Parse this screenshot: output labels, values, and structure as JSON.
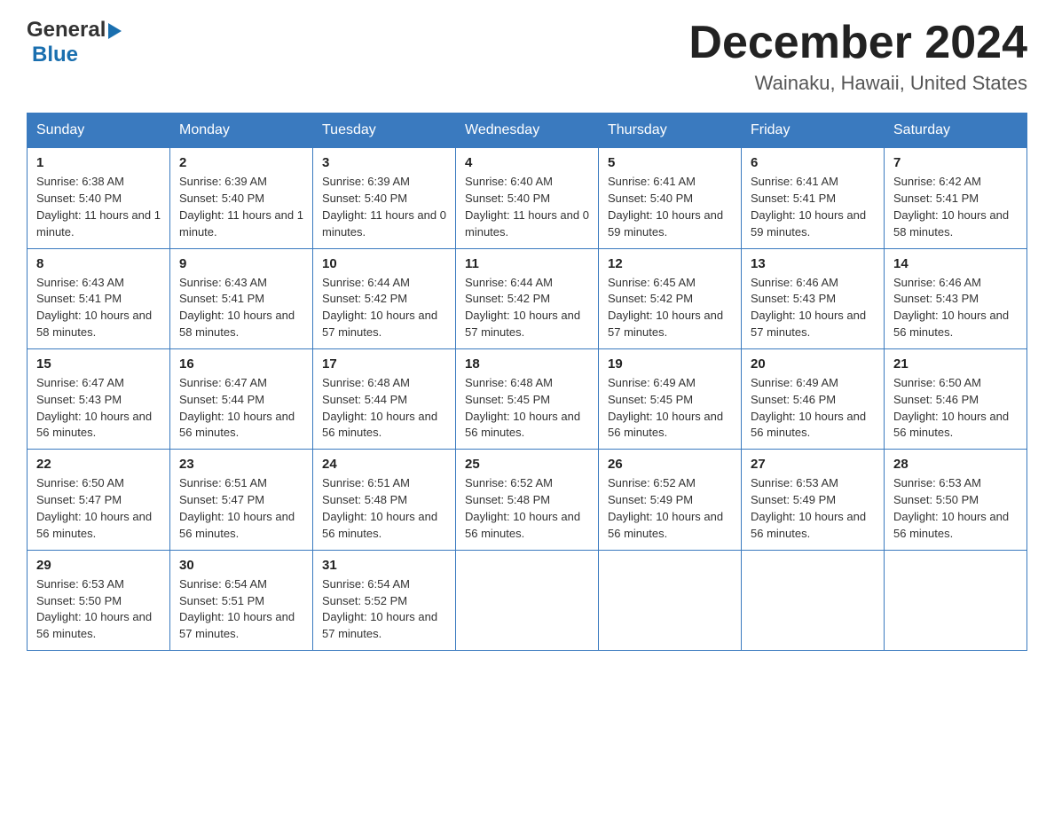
{
  "header": {
    "logo_general": "General",
    "logo_blue": "Blue",
    "month_title": "December 2024",
    "location": "Wainaku, Hawaii, United States"
  },
  "weekdays": [
    "Sunday",
    "Monday",
    "Tuesday",
    "Wednesday",
    "Thursday",
    "Friday",
    "Saturday"
  ],
  "weeks": [
    [
      {
        "day": "1",
        "sunrise": "6:38 AM",
        "sunset": "5:40 PM",
        "daylight": "11 hours and 1 minute."
      },
      {
        "day": "2",
        "sunrise": "6:39 AM",
        "sunset": "5:40 PM",
        "daylight": "11 hours and 1 minute."
      },
      {
        "day": "3",
        "sunrise": "6:39 AM",
        "sunset": "5:40 PM",
        "daylight": "11 hours and 0 minutes."
      },
      {
        "day": "4",
        "sunrise": "6:40 AM",
        "sunset": "5:40 PM",
        "daylight": "11 hours and 0 minutes."
      },
      {
        "day": "5",
        "sunrise": "6:41 AM",
        "sunset": "5:40 PM",
        "daylight": "10 hours and 59 minutes."
      },
      {
        "day": "6",
        "sunrise": "6:41 AM",
        "sunset": "5:41 PM",
        "daylight": "10 hours and 59 minutes."
      },
      {
        "day": "7",
        "sunrise": "6:42 AM",
        "sunset": "5:41 PM",
        "daylight": "10 hours and 58 minutes."
      }
    ],
    [
      {
        "day": "8",
        "sunrise": "6:43 AM",
        "sunset": "5:41 PM",
        "daylight": "10 hours and 58 minutes."
      },
      {
        "day": "9",
        "sunrise": "6:43 AM",
        "sunset": "5:41 PM",
        "daylight": "10 hours and 58 minutes."
      },
      {
        "day": "10",
        "sunrise": "6:44 AM",
        "sunset": "5:42 PM",
        "daylight": "10 hours and 57 minutes."
      },
      {
        "day": "11",
        "sunrise": "6:44 AM",
        "sunset": "5:42 PM",
        "daylight": "10 hours and 57 minutes."
      },
      {
        "day": "12",
        "sunrise": "6:45 AM",
        "sunset": "5:42 PM",
        "daylight": "10 hours and 57 minutes."
      },
      {
        "day": "13",
        "sunrise": "6:46 AM",
        "sunset": "5:43 PM",
        "daylight": "10 hours and 57 minutes."
      },
      {
        "day": "14",
        "sunrise": "6:46 AM",
        "sunset": "5:43 PM",
        "daylight": "10 hours and 56 minutes."
      }
    ],
    [
      {
        "day": "15",
        "sunrise": "6:47 AM",
        "sunset": "5:43 PM",
        "daylight": "10 hours and 56 minutes."
      },
      {
        "day": "16",
        "sunrise": "6:47 AM",
        "sunset": "5:44 PM",
        "daylight": "10 hours and 56 minutes."
      },
      {
        "day": "17",
        "sunrise": "6:48 AM",
        "sunset": "5:44 PM",
        "daylight": "10 hours and 56 minutes."
      },
      {
        "day": "18",
        "sunrise": "6:48 AM",
        "sunset": "5:45 PM",
        "daylight": "10 hours and 56 minutes."
      },
      {
        "day": "19",
        "sunrise": "6:49 AM",
        "sunset": "5:45 PM",
        "daylight": "10 hours and 56 minutes."
      },
      {
        "day": "20",
        "sunrise": "6:49 AM",
        "sunset": "5:46 PM",
        "daylight": "10 hours and 56 minutes."
      },
      {
        "day": "21",
        "sunrise": "6:50 AM",
        "sunset": "5:46 PM",
        "daylight": "10 hours and 56 minutes."
      }
    ],
    [
      {
        "day": "22",
        "sunrise": "6:50 AM",
        "sunset": "5:47 PM",
        "daylight": "10 hours and 56 minutes."
      },
      {
        "day": "23",
        "sunrise": "6:51 AM",
        "sunset": "5:47 PM",
        "daylight": "10 hours and 56 minutes."
      },
      {
        "day": "24",
        "sunrise": "6:51 AM",
        "sunset": "5:48 PM",
        "daylight": "10 hours and 56 minutes."
      },
      {
        "day": "25",
        "sunrise": "6:52 AM",
        "sunset": "5:48 PM",
        "daylight": "10 hours and 56 minutes."
      },
      {
        "day": "26",
        "sunrise": "6:52 AM",
        "sunset": "5:49 PM",
        "daylight": "10 hours and 56 minutes."
      },
      {
        "day": "27",
        "sunrise": "6:53 AM",
        "sunset": "5:49 PM",
        "daylight": "10 hours and 56 minutes."
      },
      {
        "day": "28",
        "sunrise": "6:53 AM",
        "sunset": "5:50 PM",
        "daylight": "10 hours and 56 minutes."
      }
    ],
    [
      {
        "day": "29",
        "sunrise": "6:53 AM",
        "sunset": "5:50 PM",
        "daylight": "10 hours and 56 minutes."
      },
      {
        "day": "30",
        "sunrise": "6:54 AM",
        "sunset": "5:51 PM",
        "daylight": "10 hours and 57 minutes."
      },
      {
        "day": "31",
        "sunrise": "6:54 AM",
        "sunset": "5:52 PM",
        "daylight": "10 hours and 57 minutes."
      },
      null,
      null,
      null,
      null
    ]
  ],
  "labels": {
    "sunrise": "Sunrise:",
    "sunset": "Sunset:",
    "daylight": "Daylight:"
  }
}
